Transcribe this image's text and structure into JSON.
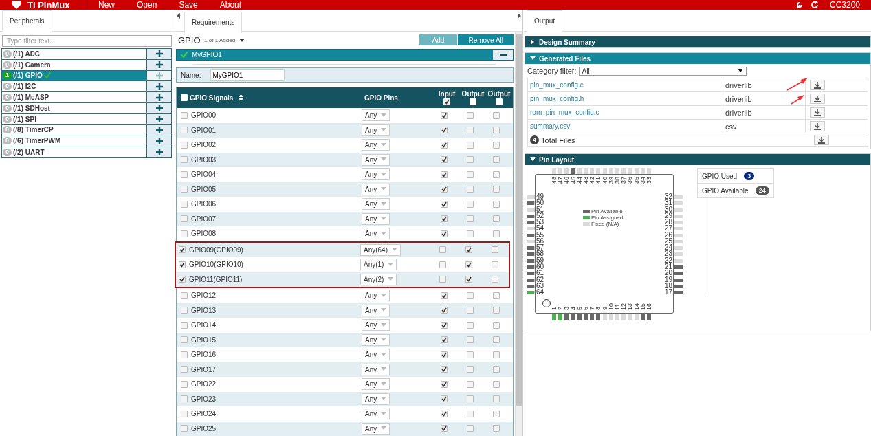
{
  "app_bar": {
    "title": "TI PinMux",
    "menu": [
      "New",
      "Open",
      "Save",
      "About"
    ],
    "device": "CC3200"
  },
  "peripherals": {
    "tab": "Peripherals",
    "filter_placeholder": "Type filter text...",
    "items": [
      {
        "count": "0",
        "total": "(/1)",
        "name": "ADC",
        "selected": false,
        "done": false
      },
      {
        "count": "0",
        "total": "(/1)",
        "name": "Camera",
        "selected": false,
        "done": false
      },
      {
        "count": "1",
        "total": "(/1)",
        "name": "GPIO",
        "selected": true,
        "done": true
      },
      {
        "count": "0",
        "total": "(/1)",
        "name": "I2C",
        "selected": false,
        "done": false
      },
      {
        "count": "0",
        "total": "(/1)",
        "name": "McASP",
        "selected": false,
        "done": false
      },
      {
        "count": "0",
        "total": "(/1)",
        "name": "SDHost",
        "selected": false,
        "done": false
      },
      {
        "count": "0",
        "total": "(/1)",
        "name": "SPI",
        "selected": false,
        "done": false
      },
      {
        "count": "0",
        "total": "(/8)",
        "name": "TimerCP",
        "selected": false,
        "done": false
      },
      {
        "count": "0",
        "total": "(/6)",
        "name": "TimerPWM",
        "selected": false,
        "done": false
      },
      {
        "count": "0",
        "total": "(/2)",
        "name": "UART",
        "selected": false,
        "done": false
      }
    ]
  },
  "requirements": {
    "tab": "Requirements",
    "heading": "GPIO",
    "added": "(1 of 1 Added)",
    "buttons": [
      {
        "label": "Add",
        "disabled": true
      },
      {
        "label": "Remove All",
        "disabled": false
      }
    ],
    "instance": {
      "name": "MyGPIO1",
      "valid": true
    },
    "name_label": "Name:",
    "name_value": "MyGPIO1",
    "table": {
      "columns": [
        {
          "label": "GPIO Signals",
          "kind": "signal",
          "checked": false
        },
        {
          "label": "GPIO Pins",
          "kind": "pins"
        },
        {
          "label": "Input",
          "kind": "check",
          "checked": true
        },
        {
          "label": "Output",
          "kind": "check",
          "checked": false
        },
        {
          "label": "Output",
          "kind": "check",
          "checked": false
        }
      ],
      "rows": [
        {
          "signal": "GPIO00",
          "checked": false,
          "pin": "Any",
          "input": true,
          "output": false,
          "output_2": false,
          "highlighted": false
        },
        {
          "signal": "GPIO01",
          "checked": false,
          "pin": "Any",
          "input": true,
          "output": false,
          "output_2": false,
          "highlighted": false
        },
        {
          "signal": "GPIO02",
          "checked": false,
          "pin": "Any",
          "input": true,
          "output": false,
          "output_2": false,
          "highlighted": false
        },
        {
          "signal": "GPIO03",
          "checked": false,
          "pin": "Any",
          "input": true,
          "output": false,
          "output_2": false,
          "highlighted": false
        },
        {
          "signal": "GPIO04",
          "checked": false,
          "pin": "Any",
          "input": true,
          "output": false,
          "output_2": false,
          "highlighted": false
        },
        {
          "signal": "GPIO05",
          "checked": false,
          "pin": "Any",
          "input": true,
          "output": false,
          "output_2": false,
          "highlighted": false
        },
        {
          "signal": "GPIO06",
          "checked": false,
          "pin": "Any",
          "input": true,
          "output": false,
          "output_2": false,
          "highlighted": false
        },
        {
          "signal": "GPIO07",
          "checked": false,
          "pin": "Any",
          "input": true,
          "output": false,
          "output_2": false,
          "highlighted": false
        },
        {
          "signal": "GPIO08",
          "checked": false,
          "pin": "Any",
          "input": true,
          "output": false,
          "output_2": false,
          "highlighted": false
        },
        {
          "signal": "GPIO09(GPIO09)",
          "checked": true,
          "pin": "Any(64)",
          "input": false,
          "output": true,
          "output_2": false,
          "highlighted": true
        },
        {
          "signal": "GPIO10(GPIO10)",
          "checked": true,
          "pin": "Any(1)",
          "input": false,
          "output": true,
          "output_2": false,
          "highlighted": true
        },
        {
          "signal": "GPIO11(GPIO11)",
          "checked": true,
          "pin": "Any(2)",
          "input": false,
          "output": true,
          "output_2": false,
          "highlighted": true
        },
        {
          "signal": "GPIO12",
          "checked": false,
          "pin": "Any",
          "input": true,
          "output": false,
          "output_2": false,
          "highlighted": false
        },
        {
          "signal": "GPIO13",
          "checked": false,
          "pin": "Any",
          "input": true,
          "output": false,
          "output_2": false,
          "highlighted": false
        },
        {
          "signal": "GPIO14",
          "checked": false,
          "pin": "Any",
          "input": true,
          "output": false,
          "output_2": false,
          "highlighted": false
        },
        {
          "signal": "GPIO15",
          "checked": false,
          "pin": "Any",
          "input": true,
          "output": false,
          "output_2": false,
          "highlighted": false
        },
        {
          "signal": "GPIO16",
          "checked": false,
          "pin": "Any",
          "input": true,
          "output": false,
          "output_2": false,
          "highlighted": false
        },
        {
          "signal": "GPIO17",
          "checked": false,
          "pin": "Any",
          "input": true,
          "output": false,
          "output_2": false,
          "highlighted": false
        },
        {
          "signal": "GPIO22",
          "checked": false,
          "pin": "Any",
          "input": true,
          "output": false,
          "output_2": false,
          "highlighted": false
        },
        {
          "signal": "GPIO23",
          "checked": false,
          "pin": "Any",
          "input": true,
          "output": false,
          "output_2": false,
          "highlighted": false
        },
        {
          "signal": "GPIO24",
          "checked": false,
          "pin": "Any",
          "input": true,
          "output": false,
          "output_2": false,
          "highlighted": false
        },
        {
          "signal": "GPIO25",
          "checked": false,
          "pin": "Any",
          "input": true,
          "output": false,
          "output_2": false,
          "highlighted": false
        }
      ]
    }
  },
  "output": {
    "tab": "Output",
    "design_summary": {
      "title": "Design Summary",
      "expanded": false
    },
    "generated_files": {
      "title": "Generated Files",
      "expanded": true,
      "filter_label": "Category filter:",
      "filter_value": "All",
      "files": [
        {
          "name": "pin_mux_config.c",
          "category": "driverlib"
        },
        {
          "name": "pin_mux_config.h",
          "category": "driverlib"
        },
        {
          "name": "rom_pin_mux_config.c",
          "category": "driverlib"
        },
        {
          "name": "summary.csv",
          "category": "csv"
        }
      ],
      "total_count": "4",
      "total_label": "Total Files"
    },
    "pin_layout": {
      "title": "Pin Layout",
      "expanded": true,
      "pins": {
        "top": [
          {
            "label": "48",
            "kind": "fixed"
          },
          {
            "label": "47",
            "kind": "fixed"
          },
          {
            "label": "46",
            "kind": "fixed"
          },
          {
            "label": "45",
            "kind": "available"
          },
          {
            "label": "44",
            "kind": "fixed"
          },
          {
            "label": "43",
            "kind": "fixed"
          },
          {
            "label": "42",
            "kind": "fixed"
          },
          {
            "label": "41",
            "kind": "fixed"
          },
          {
            "label": "40",
            "kind": "fixed"
          },
          {
            "label": "39",
            "kind": "fixed"
          },
          {
            "label": "38",
            "kind": "fixed"
          },
          {
            "label": "37",
            "kind": "fixed"
          },
          {
            "label": "36",
            "kind": "fixed"
          },
          {
            "label": "35",
            "kind": "fixed"
          },
          {
            "label": "34",
            "kind": "fixed"
          },
          {
            "label": "33",
            "kind": "fixed"
          }
        ],
        "left": [
          {
            "label": "49",
            "kind": "fixed"
          },
          {
            "label": "50",
            "kind": "available"
          },
          {
            "label": "51",
            "kind": "fixed"
          },
          {
            "label": "52",
            "kind": "available"
          },
          {
            "label": "53",
            "kind": "available"
          },
          {
            "label": "54",
            "kind": "fixed"
          },
          {
            "label": "55",
            "kind": "available"
          },
          {
            "label": "56",
            "kind": "fixed"
          },
          {
            "label": "57",
            "kind": "available"
          },
          {
            "label": "58",
            "kind": "available"
          },
          {
            "label": "59",
            "kind": "available"
          },
          {
            "label": "60",
            "kind": "available"
          },
          {
            "label": "61",
            "kind": "available"
          },
          {
            "label": "62",
            "kind": "available"
          },
          {
            "label": "63",
            "kind": "available"
          },
          {
            "label": "64",
            "kind": "assigned"
          }
        ],
        "right": [
          {
            "label": "32",
            "kind": "fixed"
          },
          {
            "label": "31",
            "kind": "fixed"
          },
          {
            "label": "30",
            "kind": "fixed"
          },
          {
            "label": "29",
            "kind": "fixed"
          },
          {
            "label": "28",
            "kind": "fixed"
          },
          {
            "label": "27",
            "kind": "fixed"
          },
          {
            "label": "26",
            "kind": "fixed"
          },
          {
            "label": "25",
            "kind": "fixed"
          },
          {
            "label": "24",
            "kind": "fixed"
          },
          {
            "label": "23",
            "kind": "fixed"
          },
          {
            "label": "22",
            "kind": "fixed"
          },
          {
            "label": "21",
            "kind": "available"
          },
          {
            "label": "20",
            "kind": "available"
          },
          {
            "label": "19",
            "kind": "available"
          },
          {
            "label": "18",
            "kind": "available"
          },
          {
            "label": "17",
            "kind": "available"
          }
        ],
        "bottom": [
          {
            "label": "1",
            "kind": "assigned"
          },
          {
            "label": "2",
            "kind": "assigned"
          },
          {
            "label": "3",
            "kind": "available"
          },
          {
            "label": "4",
            "kind": "available"
          },
          {
            "label": "5",
            "kind": "available"
          },
          {
            "label": "6",
            "kind": "available"
          },
          {
            "label": "7",
            "kind": "available"
          },
          {
            "label": "8",
            "kind": "available"
          },
          {
            "label": "9",
            "kind": "fixed"
          },
          {
            "label": "10",
            "kind": "fixed"
          },
          {
            "label": "11",
            "kind": "fixed"
          },
          {
            "label": "12",
            "kind": "fixed"
          },
          {
            "label": "13",
            "kind": "fixed"
          },
          {
            "label": "14",
            "kind": "fixed"
          },
          {
            "label": "15",
            "kind": "available"
          },
          {
            "label": "16",
            "kind": "available"
          }
        ]
      },
      "legend": [
        {
          "label": "Pin Available",
          "kind": "available"
        },
        {
          "label": "Pin Assigned",
          "kind": "assigned"
        },
        {
          "label": "Fixed (N/A)",
          "kind": "fixed"
        }
      ],
      "stats": [
        {
          "label": "GPIO Used",
          "count": "3",
          "color": "#0d2f80"
        },
        {
          "label": "GPIO Available",
          "count": "24",
          "color": "#555555"
        }
      ]
    }
  }
}
